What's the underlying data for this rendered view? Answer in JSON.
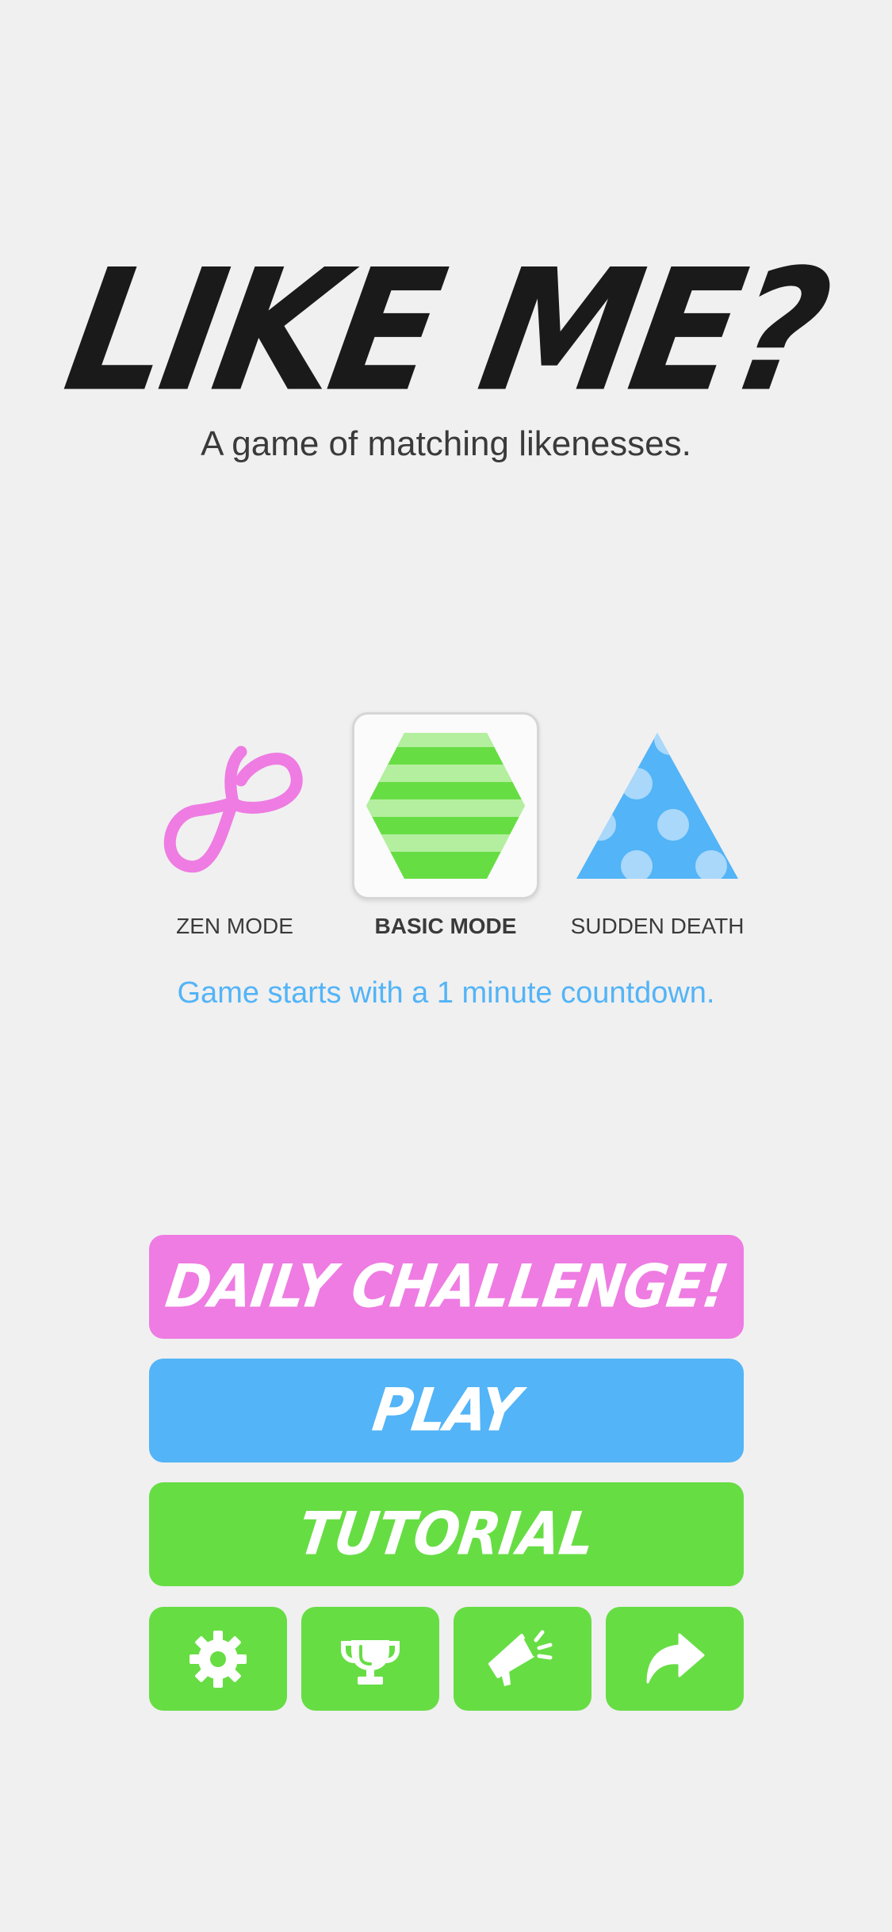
{
  "app": {
    "title": "LIKE ME?",
    "subtitle": "A game of matching likenesses."
  },
  "modes": [
    {
      "label": "ZEN MODE",
      "icon": "infinity-icon",
      "color": "#ee7ce2",
      "selected": false
    },
    {
      "label": "BASIC MODE",
      "icon": "striped-hexagon-icon",
      "color": "#67dd44",
      "selected": true
    },
    {
      "label": "SUDDEN DEATH",
      "icon": "dotted-triangle-icon",
      "color": "#53b4f7",
      "selected": false
    }
  ],
  "mode_description": "Game starts with a 1 minute countdown.",
  "buttons": {
    "daily_challenge": "DAILY CHALLENGE!",
    "play": "PLAY",
    "tutorial": "TUTORIAL"
  },
  "toolbar": [
    {
      "icon": "gear-icon"
    },
    {
      "icon": "trophy-icon"
    },
    {
      "icon": "megaphone-icon"
    },
    {
      "icon": "share-icon"
    }
  ],
  "colors": {
    "background": "#f0f0f0",
    "pink": "#ee7ce2",
    "blue": "#53b4f7",
    "green": "#67dd44",
    "title": "#1a1a1a"
  }
}
